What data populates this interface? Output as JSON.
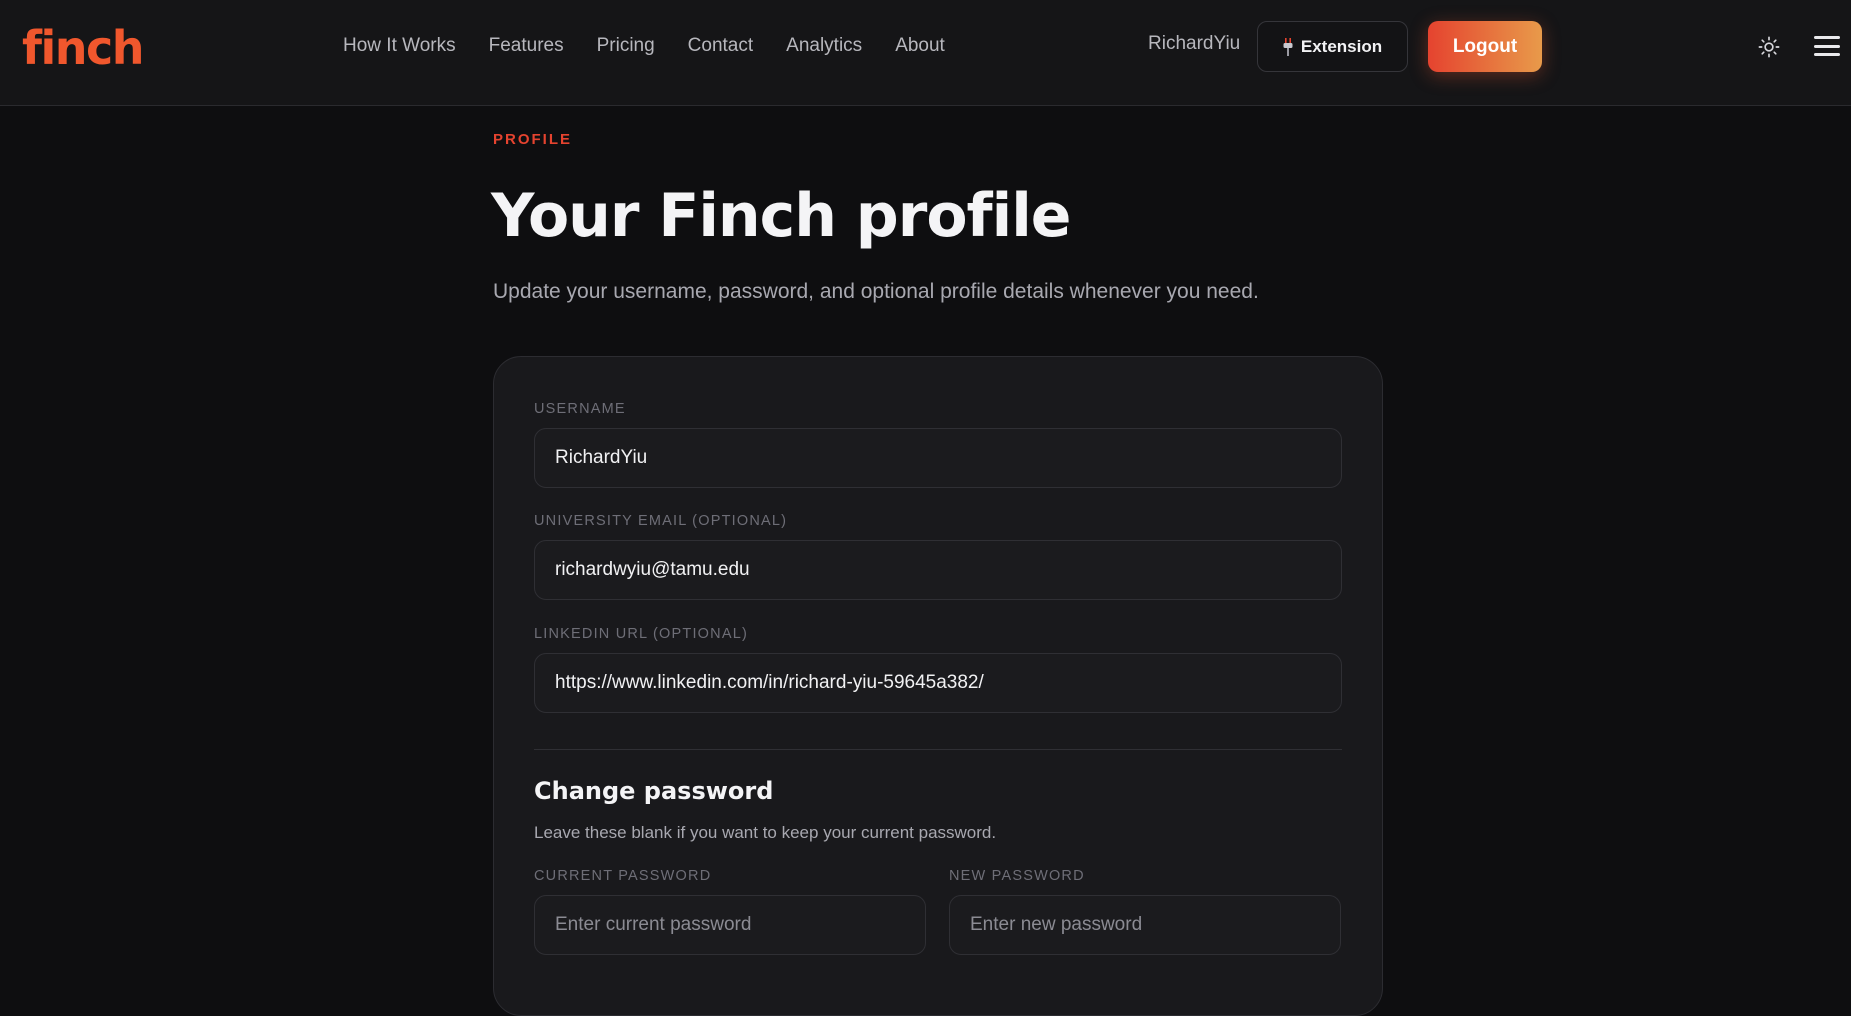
{
  "header": {
    "logo": "finch",
    "nav": [
      "How It Works",
      "Features",
      "Pricing",
      "Contact",
      "Analytics",
      "About"
    ],
    "username": "RichardYiu",
    "extension_label": "Extension",
    "logout_label": "Logout",
    "icons": {
      "extension": "plug-icon",
      "theme": "sun-icon",
      "menu": "hamburger-menu-icon"
    },
    "accent_color": "#f0572d"
  },
  "hero": {
    "eyebrow": "PROFILE",
    "title": "Your Finch profile",
    "subtitle": "Update your username, password, and optional profile details whenever you need."
  },
  "form": {
    "username": {
      "label": "USERNAME",
      "value": "RichardYiu"
    },
    "email": {
      "label": "UNIVERSITY EMAIL (OPTIONAL)",
      "value": "richardwyiu@tamu.edu"
    },
    "linkedin": {
      "label": "LINKEDIN URL (OPTIONAL)",
      "value": "https://www.linkedin.com/in/richard-yiu-59645a382/"
    },
    "password_section": {
      "title": "Change password",
      "help": "Leave these blank if you want to keep your current password.",
      "current": {
        "label": "CURRENT PASSWORD",
        "placeholder": "Enter current password"
      },
      "new": {
        "label": "NEW PASSWORD",
        "placeholder": "Enter new password"
      }
    }
  }
}
